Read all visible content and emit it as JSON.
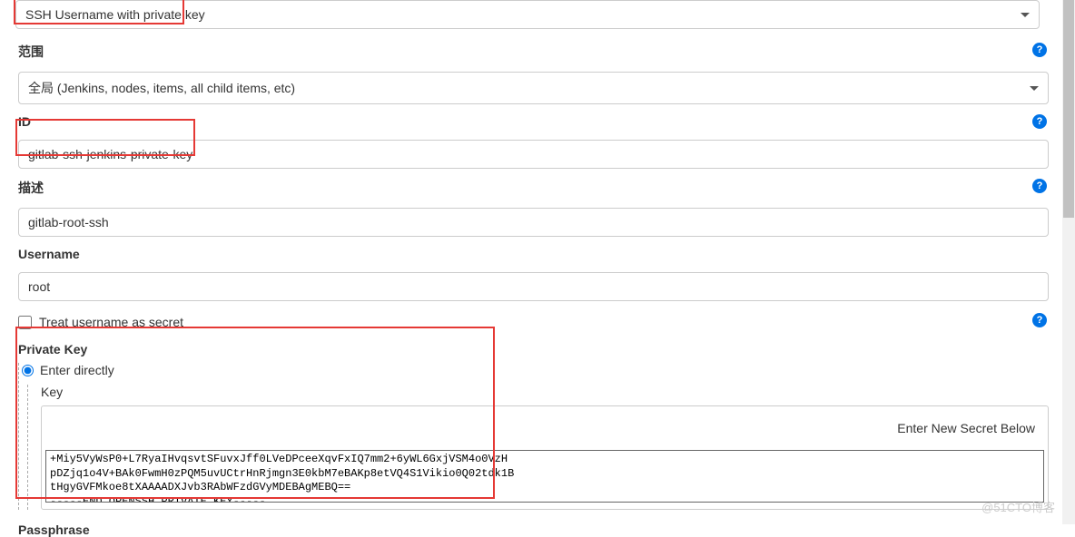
{
  "credentialType": {
    "selected": "SSH Username with private key"
  },
  "scope": {
    "label": "范围",
    "selected": "全局 (Jenkins, nodes, items, all child items, etc)"
  },
  "id": {
    "label": "ID",
    "value": "gitlab-ssh-jenkins-private-key"
  },
  "description": {
    "label": "描述",
    "value": "gitlab-root-ssh"
  },
  "username": {
    "label": "Username",
    "value": "root"
  },
  "treatSecret": {
    "label": "Treat username as secret"
  },
  "privateKey": {
    "label": "Private Key",
    "enterDirectly": "Enter directly",
    "keyLabel": "Key",
    "enterNewSecret": "Enter New Secret Below",
    "keyContent": "+Miy5VyWsP0+L7RyaIHvqsvtSFuvxJff0LVeDPceeXqvFxIQ7mm2+6yWL6GxjVSM4o0VzH\npDZjq1o4V+BAk0FwmH0zPQM5uvUCtrHnRjmgn3E0kbM7eBAKp8etVQ4S1Vikio0Q02tdk1B\ntHgyGVFMkoe8tXAAAADXJvb3RAbWFzdGVyMDEBAgMEBQ==\n-----END OPENSSH PRIVATE KEY-----"
  },
  "passphrase": {
    "label": "Passphrase"
  },
  "helpIcon": "?",
  "watermark": "@51CTO博客"
}
